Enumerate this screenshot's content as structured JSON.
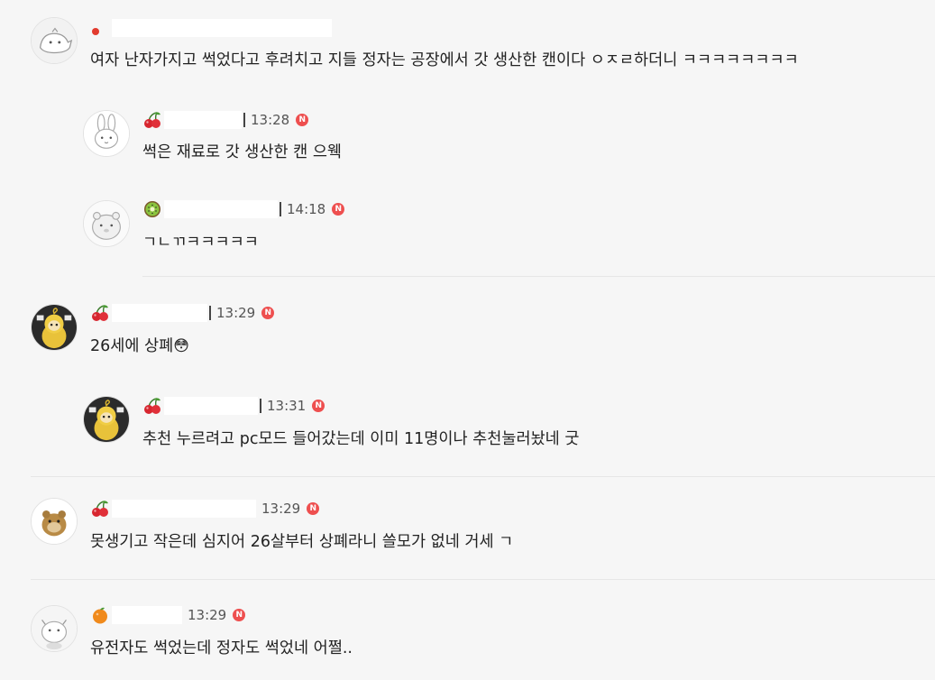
{
  "comments": [
    {
      "level_icon": "red-dot-icon",
      "time": "",
      "text": "여자 난자가지고 썩었다고 후려치고 지들 정자는 공장에서 갓 생산한 캔이다 ㅇㅈㄹ하더니 ㅋㅋㅋㅋㅋㅋㅋㅋ",
      "avatar": "dinosaur-avatar-icon"
    },
    {
      "level_icon": "cherry-icon",
      "time": "13:28",
      "text": "썩은 재료로 갓 생산한 캔 으웩",
      "avatar": "bunny-avatar-icon"
    },
    {
      "level_icon": "kiwi-icon",
      "time": "14:18",
      "text": "ㄱㄴㄲㅋㅋㅋㅋㅋ",
      "avatar": "hamster-avatar-icon"
    },
    {
      "level_icon": "cherry-icon",
      "time": "13:29",
      "text": "26세에 상폐",
      "emoji": "😳",
      "avatar": "teletubby-avatar-icon"
    },
    {
      "level_icon": "cherry-icon",
      "time": "13:31",
      "text": "추천 누르려고 pc모드 들어갔는데 이미 11명이나 추천눌러놨네 굿",
      "avatar": "teletubby-avatar-icon"
    },
    {
      "level_icon": "cherry-icon",
      "time": "13:29",
      "text": "못생기고 작은데 심지어 26살부터 상폐라니 쓸모가 없네 거세 ㄱ",
      "avatar": "hamster-photo-avatar-icon"
    },
    {
      "level_icon": "orange-icon",
      "time": "13:29",
      "text": "유전자도 썩었는데 정자도 썩었네 어쩔..",
      "avatar": "cat-avatar-icon"
    }
  ],
  "badge_label": "N",
  "colors": {
    "badge": "#ee4f4f",
    "background": "#f6f6f6"
  }
}
